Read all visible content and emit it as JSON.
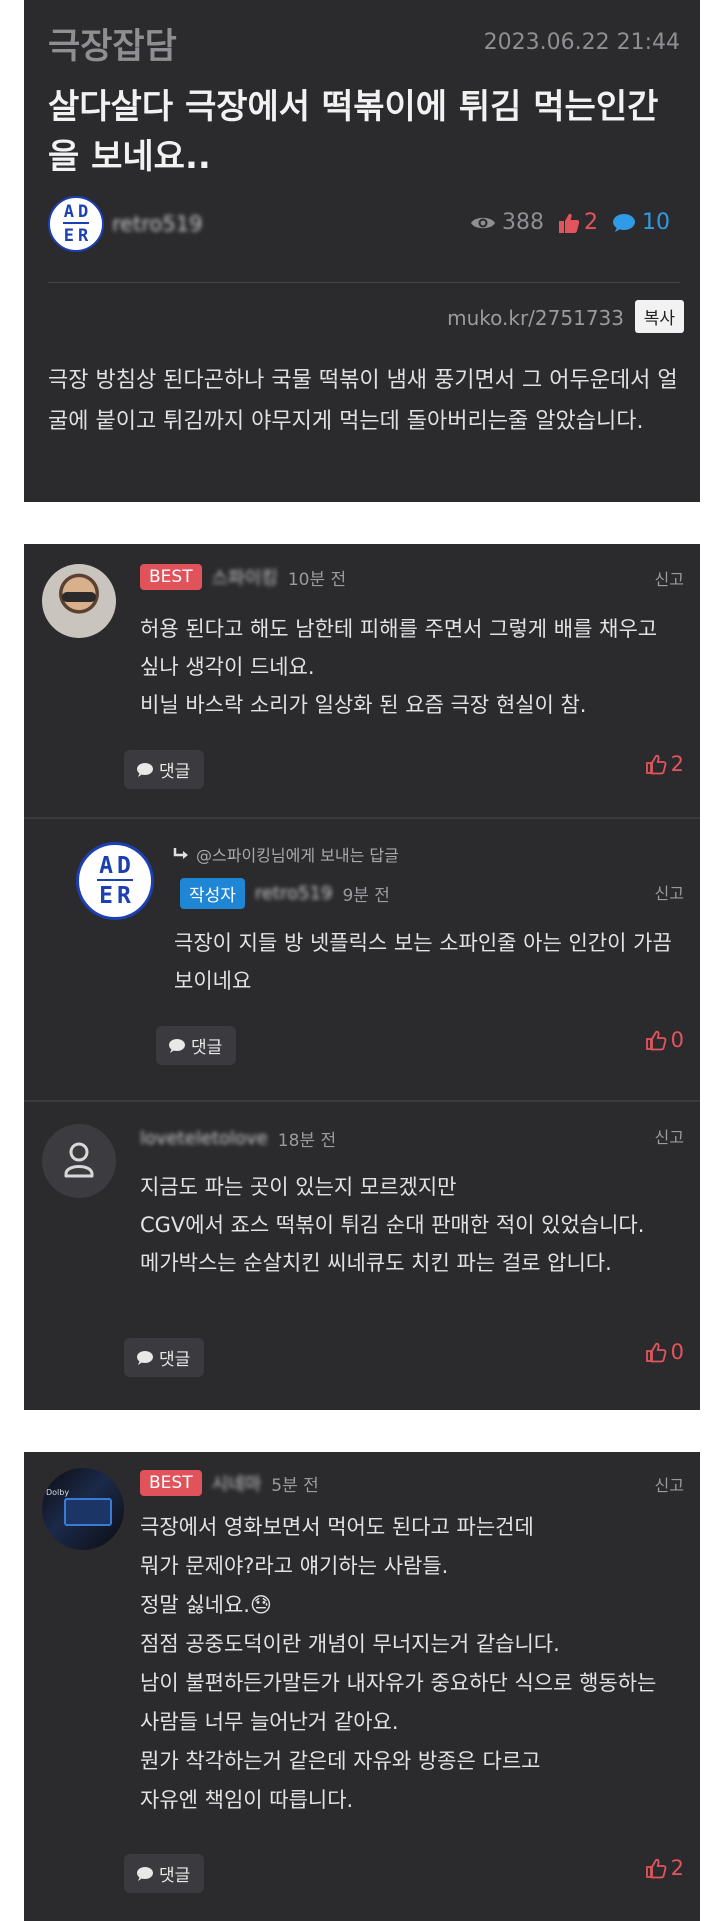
{
  "post": {
    "category": "극장잡담",
    "date": "2023.06.22 21:44",
    "title": "살다살다 극장에서 떡볶이에 튀김 먹는인간을 보네요..",
    "author": "retro519",
    "views": "388",
    "likes": "2",
    "comments": "10",
    "short_url": "muko.kr/2751733",
    "copy_label": "복사",
    "body": "극장 방침상 된다곤하나 국물 떡볶이 냄새 풍기면서 그 어두운데서 얼굴에 붙이고 튀김까지 야무지게 먹는데 돌아버리는줄 알았습니다."
  },
  "comments": [
    {
      "badge": "BEST",
      "nickname": "스파이킹",
      "time": "10분 전",
      "report": "신고",
      "body": [
        "허용 된다고 해도 남한테 피해를 주면서 그렇게 배를 채우고 싶나 생각이 드네요.",
        "비닐 바스락 소리가 일상화 된 요즘 극장 현실이 참."
      ],
      "reply_label": "댓글",
      "likes": "2"
    },
    {
      "reply_to": "@스파이킹님에게 보내는 답글",
      "badge": "작성자",
      "nickname": "retro519",
      "time": "9분 전",
      "report": "신고",
      "body": [
        "극장이 지들 방 넷플릭스 보는 소파인줄 아는 인간이 가끔 보이네요"
      ],
      "reply_label": "댓글",
      "likes": "0"
    },
    {
      "nickname": "loveteletolove",
      "time": "18분 전",
      "report": "신고",
      "body": [
        "지금도 파는 곳이 있는지 모르겠지만",
        "CGV에서 죠스 떡볶이 튀김 순대 판매한 적이 있었습니다.",
        "메가박스는 순살치킨 씨네큐도 치킨 파는 걸로 압니다."
      ],
      "reply_label": "댓글",
      "likes": "0"
    },
    {
      "badge": "BEST",
      "nickname": "시네마",
      "time": "5분 전",
      "report": "신고",
      "body": [
        "극장에서 영화보면서 먹어도 된다고 파는건데",
        "뭐가 문제야?라고 얘기하는 사람들.",
        "정말 싫네요.😓",
        "점점 공중도덕이란 개념이 무너지는거 같습니다.",
        "남이 불편하든가말든가 내자유가 중요하단 식으로 행동하는 사람들 너무 늘어난거 같아요.",
        "뭔가 착각하는거 같은데 자유와 방종은 다르고",
        "자유엔 책임이 따릅니다."
      ],
      "reply_label": "댓글",
      "likes": "2"
    }
  ],
  "avatar_letters": "ADER",
  "avatar_sub": "error",
  "colors": {
    "panel": "#2b2b2e",
    "best": "#e0535a",
    "author_badge": "#1f86d6",
    "like_red": "#e4545c",
    "comment_blue": "#2f9be6"
  }
}
